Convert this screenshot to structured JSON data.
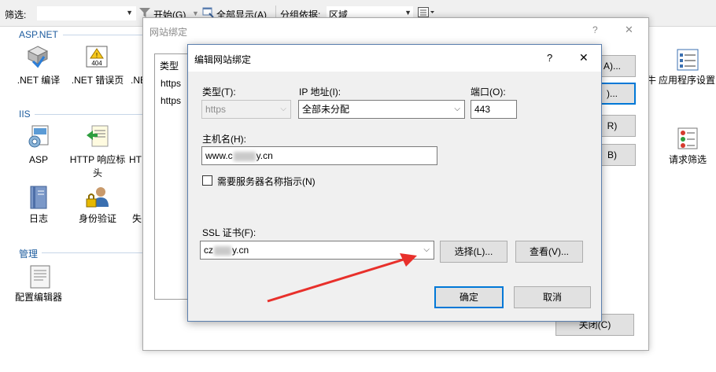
{
  "toolbar": {
    "filter_label": "筛选:",
    "start_label": "开始(G)",
    "show_all_label": "全部显示(A)",
    "group_by_label": "分组依据:",
    "group_by_value": "区域"
  },
  "groups": {
    "aspnet": "ASP.NET",
    "iis": "IIS",
    "manage": "管理"
  },
  "features": {
    "net_compile": ".NET 编译",
    "net_error_pages": ".NET 错误页",
    "net_partial": ".NE",
    "asp": "ASP",
    "http_headers": "HTTP 响应标头",
    "ht_partial": "HT",
    "logging": "日志",
    "auth": "身份验证",
    "fail_partial": "失",
    "config_editor": "配置编辑器",
    "app_settings": "应用程序设置",
    "request_filtering": "请求筛选",
    "partial_piece": "牛"
  },
  "bg_dialog": {
    "title": "网站绑定",
    "help": "?",
    "close": "✕",
    "col_type": "类型",
    "rows": [
      "https",
      "https"
    ],
    "btn_add": "A)...",
    "btn_edit": ")...",
    "btn_remove": "R)",
    "btn_browse": "B)",
    "btn_close": "关闭(C)"
  },
  "fg_dialog": {
    "title": "编辑网站绑定",
    "help": "?",
    "close": "✕",
    "type_label": "类型(T):",
    "type_value": "https",
    "ip_label": "IP 地址(I):",
    "ip_value": "全部未分配",
    "port_label": "端口(O):",
    "port_value": "443",
    "host_label": "主机名(H):",
    "host_prefix": "www.c",
    "host_suffix": "y.cn",
    "sni_label": "需要服务器名称指示(N)",
    "ssl_label": "SSL 证书(F):",
    "ssl_prefix": "cz",
    "ssl_suffix": "y.cn",
    "select_btn": "选择(L)...",
    "view_btn": "查看(V)...",
    "ok_btn": "确定",
    "cancel_btn": "取消"
  },
  "colors": {
    "accent": "#0078d7",
    "arrow": "#e8302b",
    "group_title": "#1c5b9e"
  }
}
